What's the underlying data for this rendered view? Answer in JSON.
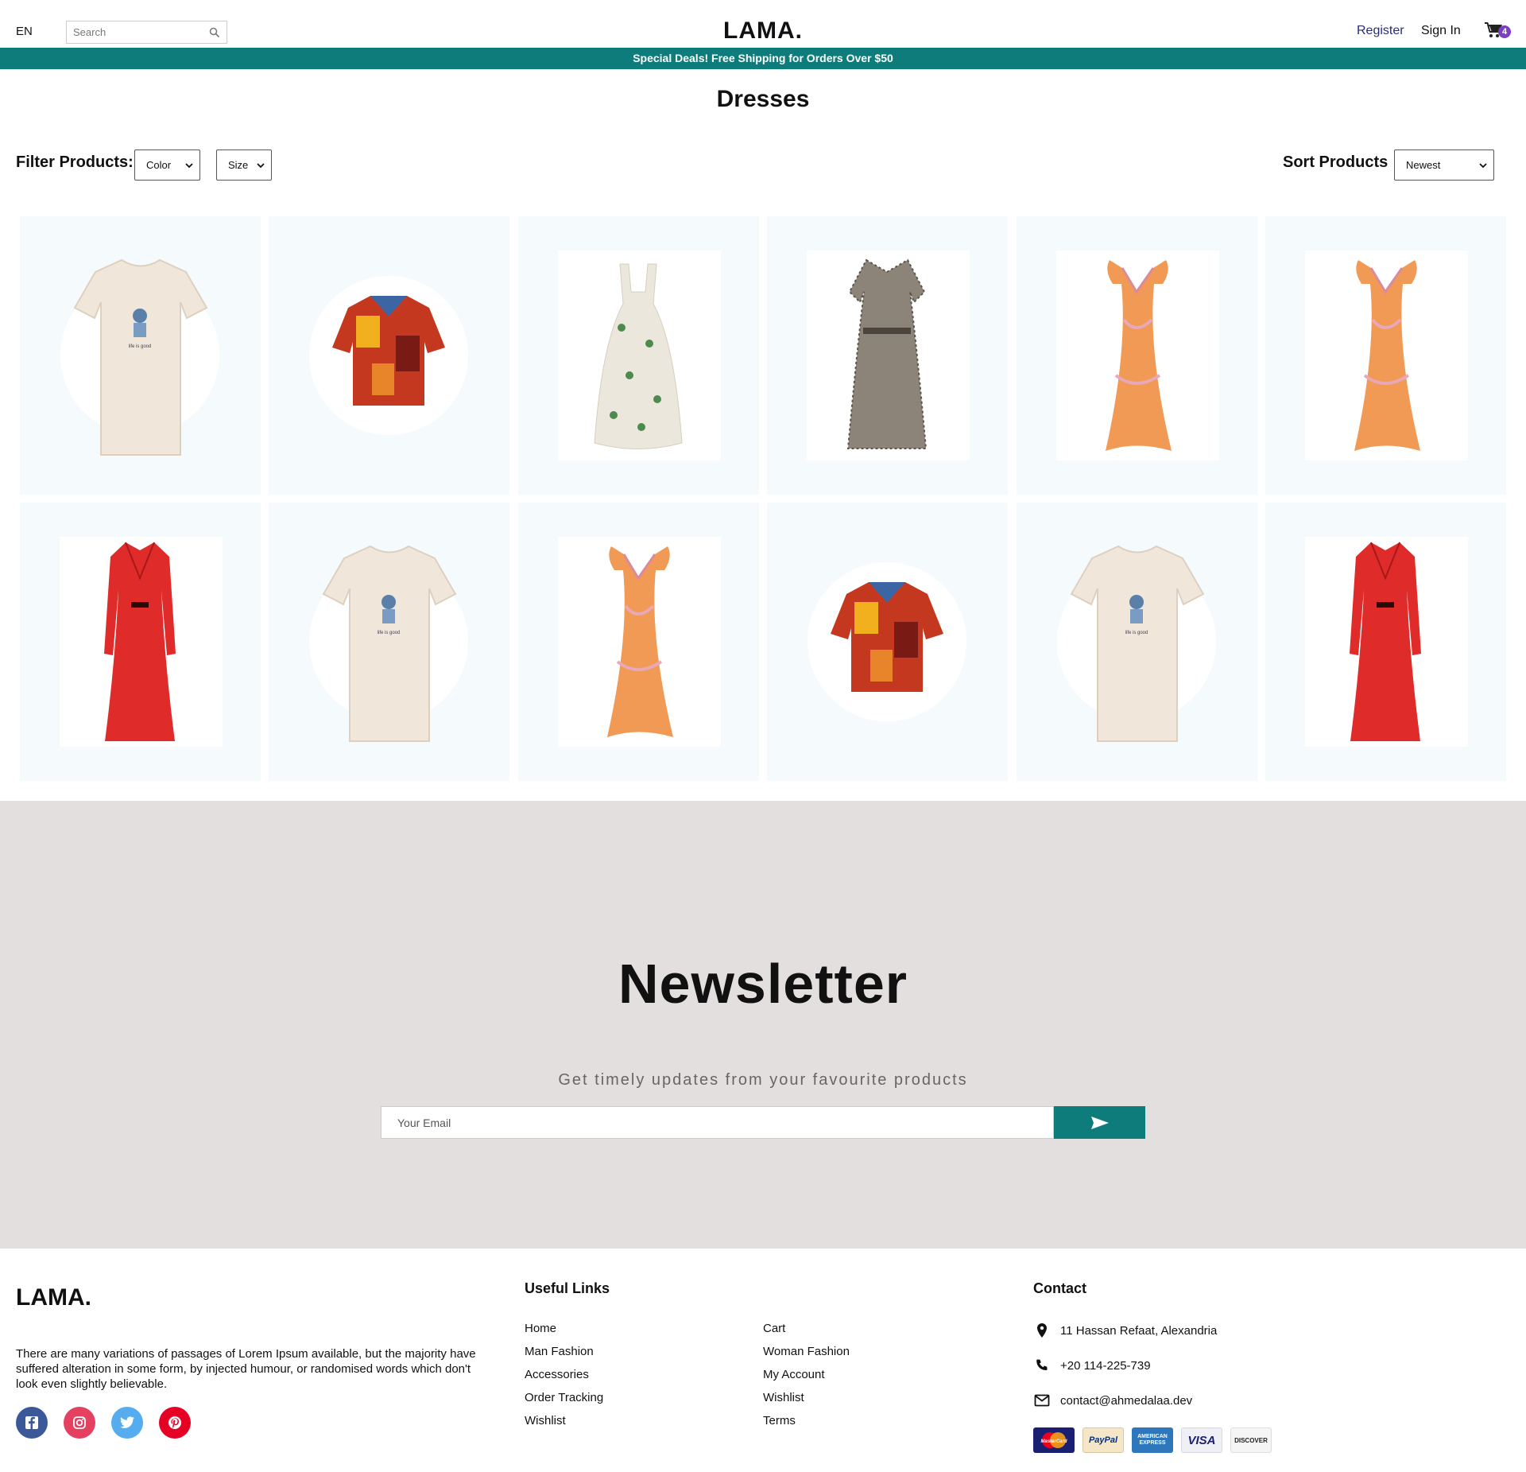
{
  "navbar": {
    "language": "EN",
    "search_placeholder": "Search",
    "logo": "LAMA.",
    "register": "Register",
    "sign_in": "Sign In",
    "cart_count": "4"
  },
  "announcement": "Special Deals! Free Shipping for Orders Over $50",
  "page_title": "Dresses",
  "filters": {
    "label": "Filter Products:",
    "color_selected": "Color",
    "size_selected": "Size",
    "sort_label": "Sort Products",
    "sort_selected": "Newest"
  },
  "products": [
    {
      "kind": "tshirt"
    },
    {
      "kind": "shirt"
    },
    {
      "kind": "floral-dress"
    },
    {
      "kind": "pattern-dress"
    },
    {
      "kind": "orange-dress"
    },
    {
      "kind": "orange-dress"
    },
    {
      "kind": "red-dress"
    },
    {
      "kind": "tshirt"
    },
    {
      "kind": "orange-dress"
    },
    {
      "kind": "shirt"
    },
    {
      "kind": "tshirt"
    },
    {
      "kind": "red-dress"
    }
  ],
  "newsletter": {
    "title": "Newsletter",
    "description": "Get timely updates from your favourite products",
    "email_placeholder": "Your Email"
  },
  "footer": {
    "logo": "LAMA.",
    "description": "There are many variations of passages of Lorem Ipsum available, but the majority have suffered alteration in some form, by injected humour, or randomised words which don't look even slightly believable.",
    "social": [
      "facebook-icon",
      "instagram-icon",
      "twitter-icon",
      "pinterest-icon"
    ],
    "useful_links_title": "Useful Links",
    "links_col1": [
      "Home",
      "Man Fashion",
      "Accessories",
      "Order Tracking",
      "Wishlist"
    ],
    "links_col2": [
      "Cart",
      "Woman Fashion",
      "My Account",
      "Wishlist",
      "Terms"
    ],
    "contact_title": "Contact",
    "address": "11 Hassan Refaat, Alexandria",
    "phone": "+20 114-225-739",
    "email": "contact@ahmedalaa.dev",
    "payments": [
      "MasterCard",
      "PayPal",
      "AMERICAN EXPRESS",
      "VISA",
      "DISCOVER"
    ]
  },
  "colors": {
    "accent": "#0f7c7c",
    "newsletter_bg": "#e3dfdf",
    "card_bg": "#f5fbfd"
  }
}
